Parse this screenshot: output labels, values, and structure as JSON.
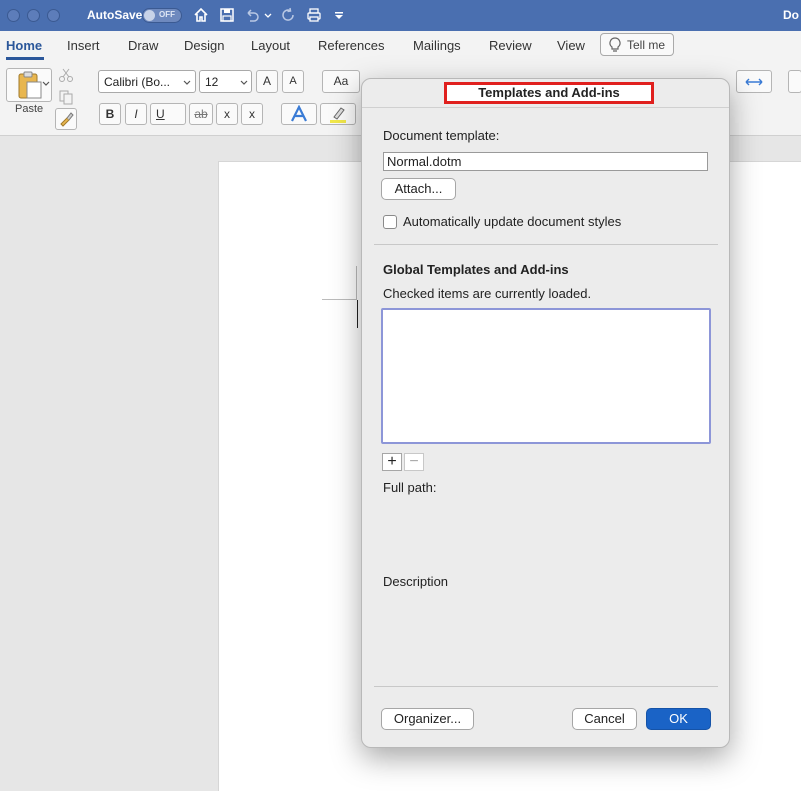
{
  "titlebar": {
    "autosave_label": "AutoSave",
    "toggle_state": "OFF",
    "doc_title": "Do"
  },
  "ribbon_tabs": [
    "Home",
    "Insert",
    "Draw",
    "Design",
    "Layout",
    "References",
    "Mailings",
    "Review",
    "View"
  ],
  "tell_me": "Tell me",
  "ribbon": {
    "paste_label": "Paste",
    "font_name": "Calibri (Bo...",
    "font_size": "12",
    "bold": "B",
    "italic": "I",
    "underline": "U",
    "strike": "ab",
    "subscript": "x",
    "superscript": "x",
    "grow": "A",
    "shrink": "A",
    "change_case": "Aa"
  },
  "dialog": {
    "title": "Templates and Add-ins",
    "document_template_label": "Document template:",
    "template_value": "Normal.dotm",
    "attach_label": "Attach...",
    "auto_update_label": "Automatically update document styles",
    "auto_update_checked": false,
    "global_heading": "Global Templates and Add-ins",
    "checked_note": "Checked items are currently loaded.",
    "add_label": "+",
    "remove_label": "−",
    "full_path_label": "Full path:",
    "description_label": "Description",
    "organizer_label": "Organizer...",
    "cancel_label": "Cancel",
    "ok_label": "OK"
  },
  "colors": {
    "titlebar": "#4a6fb0",
    "accent": "#2b579a",
    "ok_button": "#1a63c6",
    "highlight_box": "#e0201e"
  }
}
